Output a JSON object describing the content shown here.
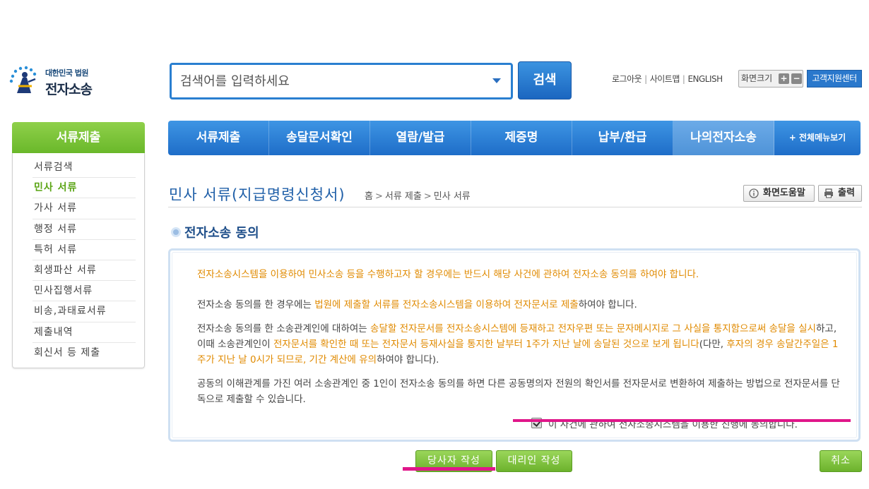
{
  "logo": {
    "sub": "대한민국 법원",
    "main": "전자소송"
  },
  "search": {
    "placeholder": "검색어를 입력하세요",
    "button_label": "검색"
  },
  "utility": {
    "logout": "로그아웃",
    "sitemap": "사이트맵",
    "english": "ENGLISH",
    "zoom_label": "화면크기",
    "zoom_in": "+",
    "zoom_out": "−",
    "support": "고객지원센터"
  },
  "nav": {
    "items": [
      "서류제출",
      "송달문서확인",
      "열람/발급",
      "제증명",
      "납부/환급",
      "나의전자소송"
    ],
    "all_menu": "+ 전체메뉴보기"
  },
  "sidebar": {
    "title": "서류제출",
    "items": [
      "서류검색",
      "민사 서류",
      "가사 서류",
      "행정 서류",
      "특허 서류",
      "회생파산 서류",
      "민사집행서류",
      "비송,과태료서류",
      "제출내역",
      "회신서 등 제출"
    ],
    "active_index": 1
  },
  "page": {
    "title": "민사 서류(지급명령신청서)",
    "breadcrumb": [
      "홈",
      "서류 제출",
      "민사 서류"
    ],
    "help_button": "화면도움말",
    "print_button": "출력"
  },
  "section": {
    "title": "전자소송 동의"
  },
  "agreement": {
    "p1": "전자소송시스템을 이용하여 민사소송 등을 수행하고자 할 경우에는 반드시 해당 사건에 관하여 전자소송 동의를 하여야 합니다.",
    "p2_a": "전자소송 동의를 한 경우에는 ",
    "p2_b": "법원에 제출할 서류를 전자소송시스템을 이용하여 전자문서로 제출",
    "p2_c": "하여야 합니다.",
    "p3_a": "전자소송 동의를 한 소송관계인에 대하여는 ",
    "p3_b": "송달할 전자문서를 전자소송시스템에 등재하고 전자우편 또는 문자메시지로 그 사실을 통지함으로써 송달을 실시",
    "p3_c": "하고, 이때 소송관계인이 ",
    "p3_d": "전자문서를 확인한 때 또는 전자문서 등재사실을 통지한 날부터 1주가 지난 날에 송달된 것으로 보게 됩니다",
    "p3_e": "(다만, ",
    "p3_f": "후자의 경우 송달간주일은 1주가 지난 날 0시가 되므로, 기간 계산에 유의",
    "p3_g": "하여야 합니다).",
    "p4": "공동의 이해관계를 가진 여러 소송관계인 중 1인이 전자소송 동의를 하면 다른 공동명의자 전원의 확인서를 전자문서로 변환하여 제출하는 방법으로 전자문서를 단독으로 제출할 수 있습니다.",
    "consent_label": "이 사건에 관하여 전자소송시스템을 이용한 진행에 동의합니다.",
    "consent_checked": true
  },
  "buttons": {
    "party": "당사자 작성",
    "agent": "대리인 작성",
    "cancel": "취소"
  }
}
